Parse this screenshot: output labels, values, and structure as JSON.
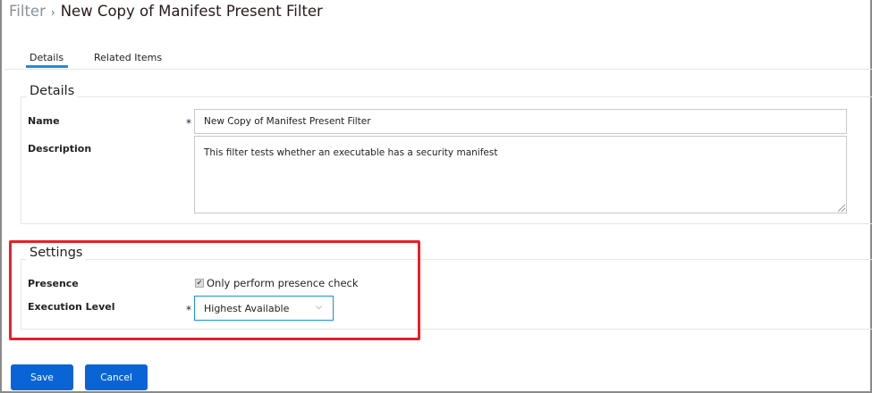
{
  "header": {
    "breadcrumb_parent": "Filter",
    "separator": "›",
    "title": "New Copy of Manifest Present Filter"
  },
  "tabs": [
    {
      "label": "Details",
      "active": true
    },
    {
      "label": "Related Items",
      "active": false
    }
  ],
  "details": {
    "legend": "Details",
    "name_label": "Name",
    "name_value": "New Copy of Manifest Present Filter",
    "description_label": "Description",
    "description_value": "This filter tests whether an executable has a security manifest",
    "required_mark": "*"
  },
  "settings": {
    "legend": "Settings",
    "presence_label": "Presence",
    "presence_checkbox_label": "Only perform presence check",
    "presence_checked": true,
    "execution_level_label": "Execution Level",
    "execution_level_value": "Highest Available",
    "required_mark": "*"
  },
  "buttons": {
    "save": "Save",
    "cancel": "Cancel"
  },
  "colors": {
    "accent": "#0a64d6",
    "tab_underline": "#1a8fe3",
    "highlight_box": "#e8202a"
  }
}
